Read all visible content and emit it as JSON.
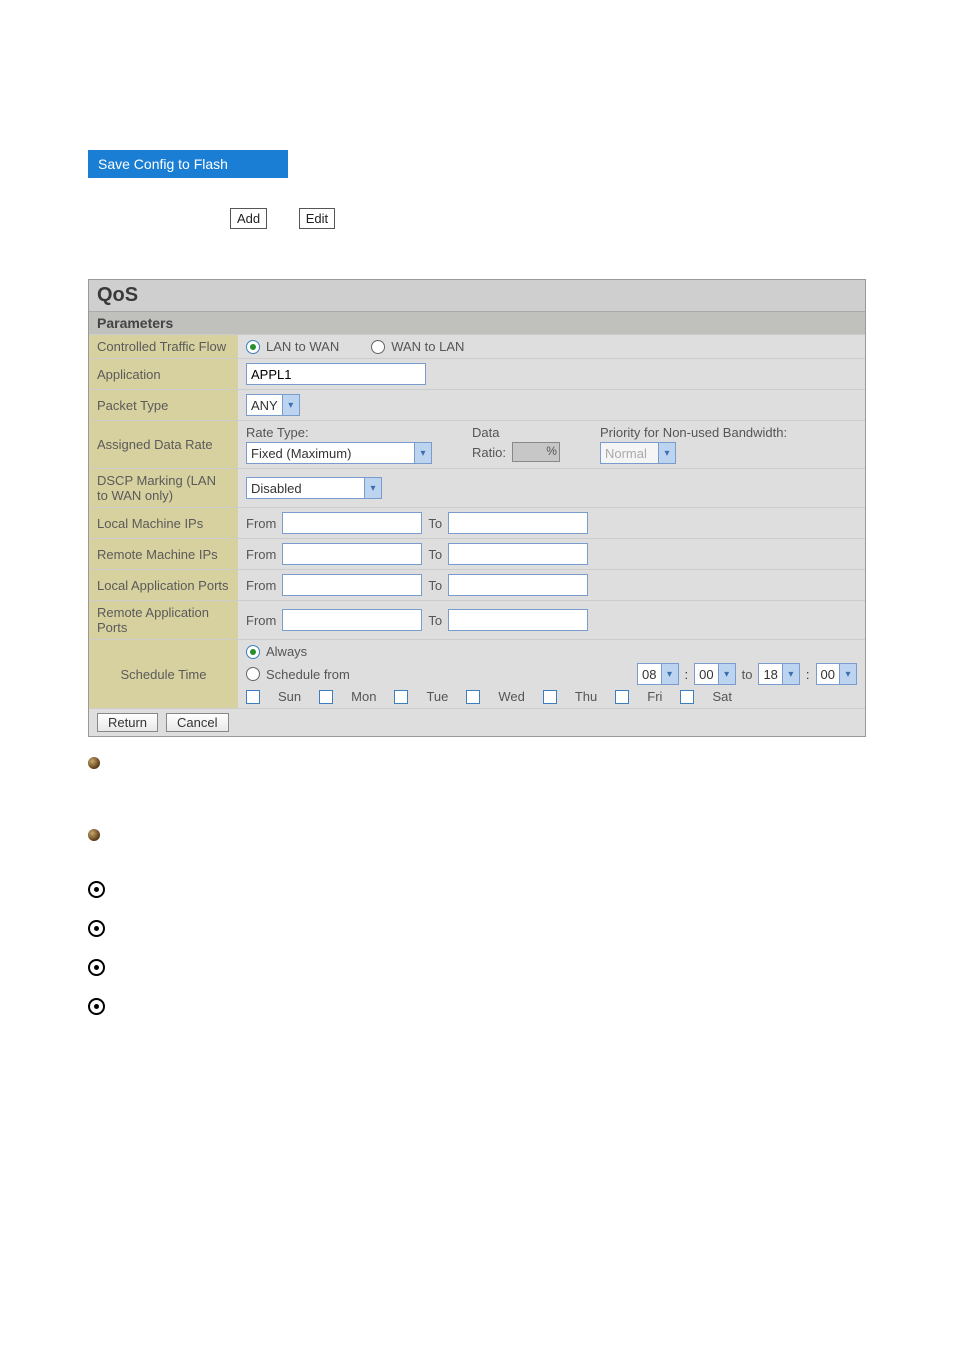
{
  "saveConfig": "Save Config to Flash",
  "buttons": {
    "add": "Add",
    "edit": "Edit",
    "return": "Return",
    "cancel": "Cancel"
  },
  "panel": {
    "title": "QoS",
    "subtitle": "Parameters",
    "labels": {
      "controlled": "Controlled Traffic Flow",
      "application": "Application",
      "packetType": "Packet Type",
      "assignedRate": "Assigned Data Rate",
      "dscp": "DSCP Marking (LAN to WAN only)",
      "localIPs": "Local Machine IPs",
      "remoteIPs": "Remote Machine IPs",
      "localPorts": "Local Application Ports",
      "remotePorts": "Remote Application Ports",
      "schedule": "Schedule Time"
    },
    "traffic": {
      "lanToWan": "LAN to WAN",
      "wanToLan": "WAN to LAN"
    },
    "applicationValue": "APPL1",
    "packetTypeValue": "ANY",
    "rate": {
      "rateTypeLabel": "Rate Type:",
      "rateTypeValue": "Fixed (Maximum)",
      "dataRatioLabel1": "Data",
      "dataRatioLabel2": "Ratio:",
      "priorityLabel": "Priority for Non-used Bandwidth:",
      "priorityValue": "Normal"
    },
    "dscpValue": "Disabled",
    "fromTo": {
      "from": "From",
      "to": "To"
    },
    "schedule": {
      "always": "Always",
      "scheduleFrom": "Schedule from",
      "to": "to",
      "h1": "08",
      "m1": "00",
      "h2": "18",
      "m2": "00",
      "days": {
        "sun": "Sun",
        "mon": "Mon",
        "tue": "Tue",
        "wed": "Wed",
        "thu": "Thu",
        "fri": "Fri",
        "sat": "Sat"
      },
      "colon": ":"
    }
  }
}
